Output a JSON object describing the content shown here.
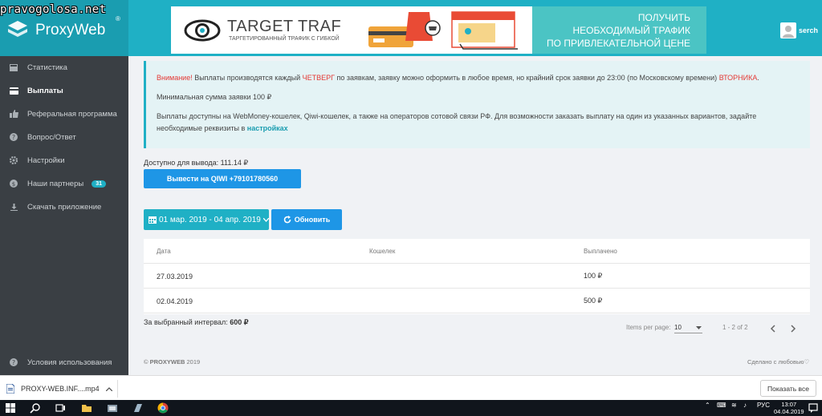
{
  "watermark": "pravogolosa.net",
  "brand": {
    "name": "ProxyWeb",
    "reg": "®"
  },
  "banner": {
    "title": "TARGET TRAF",
    "subtitle": "ТАРГЕТИРОВАННЫЙ ТРАФИК С ГИБКОЙ",
    "promo": [
      "ПОЛУЧИТЬ",
      "НЕОБХОДИМЫЙ ТРАФИК",
      "ПО ПРИВЛЕКАТЕЛЬНОЙ ЦЕНЕ"
    ]
  },
  "user": {
    "name": "serch"
  },
  "sidebar": {
    "items": [
      {
        "label": "Статистика",
        "icon": "bar-chart-icon"
      },
      {
        "label": "Выплаты",
        "icon": "credit-card-icon",
        "active": true
      },
      {
        "label": "Реферальная программа",
        "icon": "thumbs-up-icon"
      },
      {
        "label": "Вопрос/Ответ",
        "icon": "question-icon"
      },
      {
        "label": "Настройки",
        "icon": "gear-icon"
      },
      {
        "label": "Наши партнеры",
        "icon": "dollar-icon",
        "badge": "31"
      },
      {
        "label": "Скачать приложение",
        "icon": "download-icon"
      }
    ],
    "terms": "Условия использования"
  },
  "alert": {
    "warn": "Внимание!",
    "p1_a": " Выплаты производятся каждый ",
    "thursday": "ЧЕТВЕРГ",
    "p1_b": " по заявкам, заявку можно оформить в любое время, но крайний срок заявки до 23:00 (по Московскому времени) ",
    "tuesday": "ВТОРНИКА",
    "p1_c": ".",
    "p2": "Минимальная сумма заявки 100 ₽",
    "p3": "Выплаты доступны на WebMoney-кошелек, Qiwi-кошелек, а также на операторов сотовой связи РФ. Для возможности заказать выплату на один из указанных вариантов, задайте необходимые реквизиты в ",
    "settings_link": "настройках"
  },
  "available": "Доступно для вывода: 111.14 ₽",
  "withdraw_button": "Вывести на QIWI +79101780560",
  "date_range": "01 мар. 2019 - 04 апр. 2019",
  "refresh_button": "Обновить",
  "table": {
    "headers": [
      "Дата",
      "Кошелек",
      "Выплачено"
    ],
    "rows": [
      [
        "27.03.2019",
        "",
        "100 ₽"
      ],
      [
        "02.04.2019",
        "",
        "500 ₽"
      ]
    ]
  },
  "total": {
    "label": "За выбранный интервал:",
    "value": "600 ₽"
  },
  "pager": {
    "per_page_label": "Items per page:",
    "per_page": "10",
    "range": "1 - 2 of 2"
  },
  "footer": {
    "copyright": "PROXYWEB",
    "year": "2019",
    "made": "Сделано с любовью♡"
  },
  "download": {
    "file": "PROXY-WEB.INF....mp4",
    "show_all": "Показать все"
  },
  "taskbar": {
    "lang": "РУС",
    "time": "13:07",
    "date": "04.04.2019"
  },
  "colors": {
    "accent": "#1fb0c5",
    "primary": "#1e96e6",
    "sidebar": "#3a3f44",
    "warn": "#e53935"
  }
}
